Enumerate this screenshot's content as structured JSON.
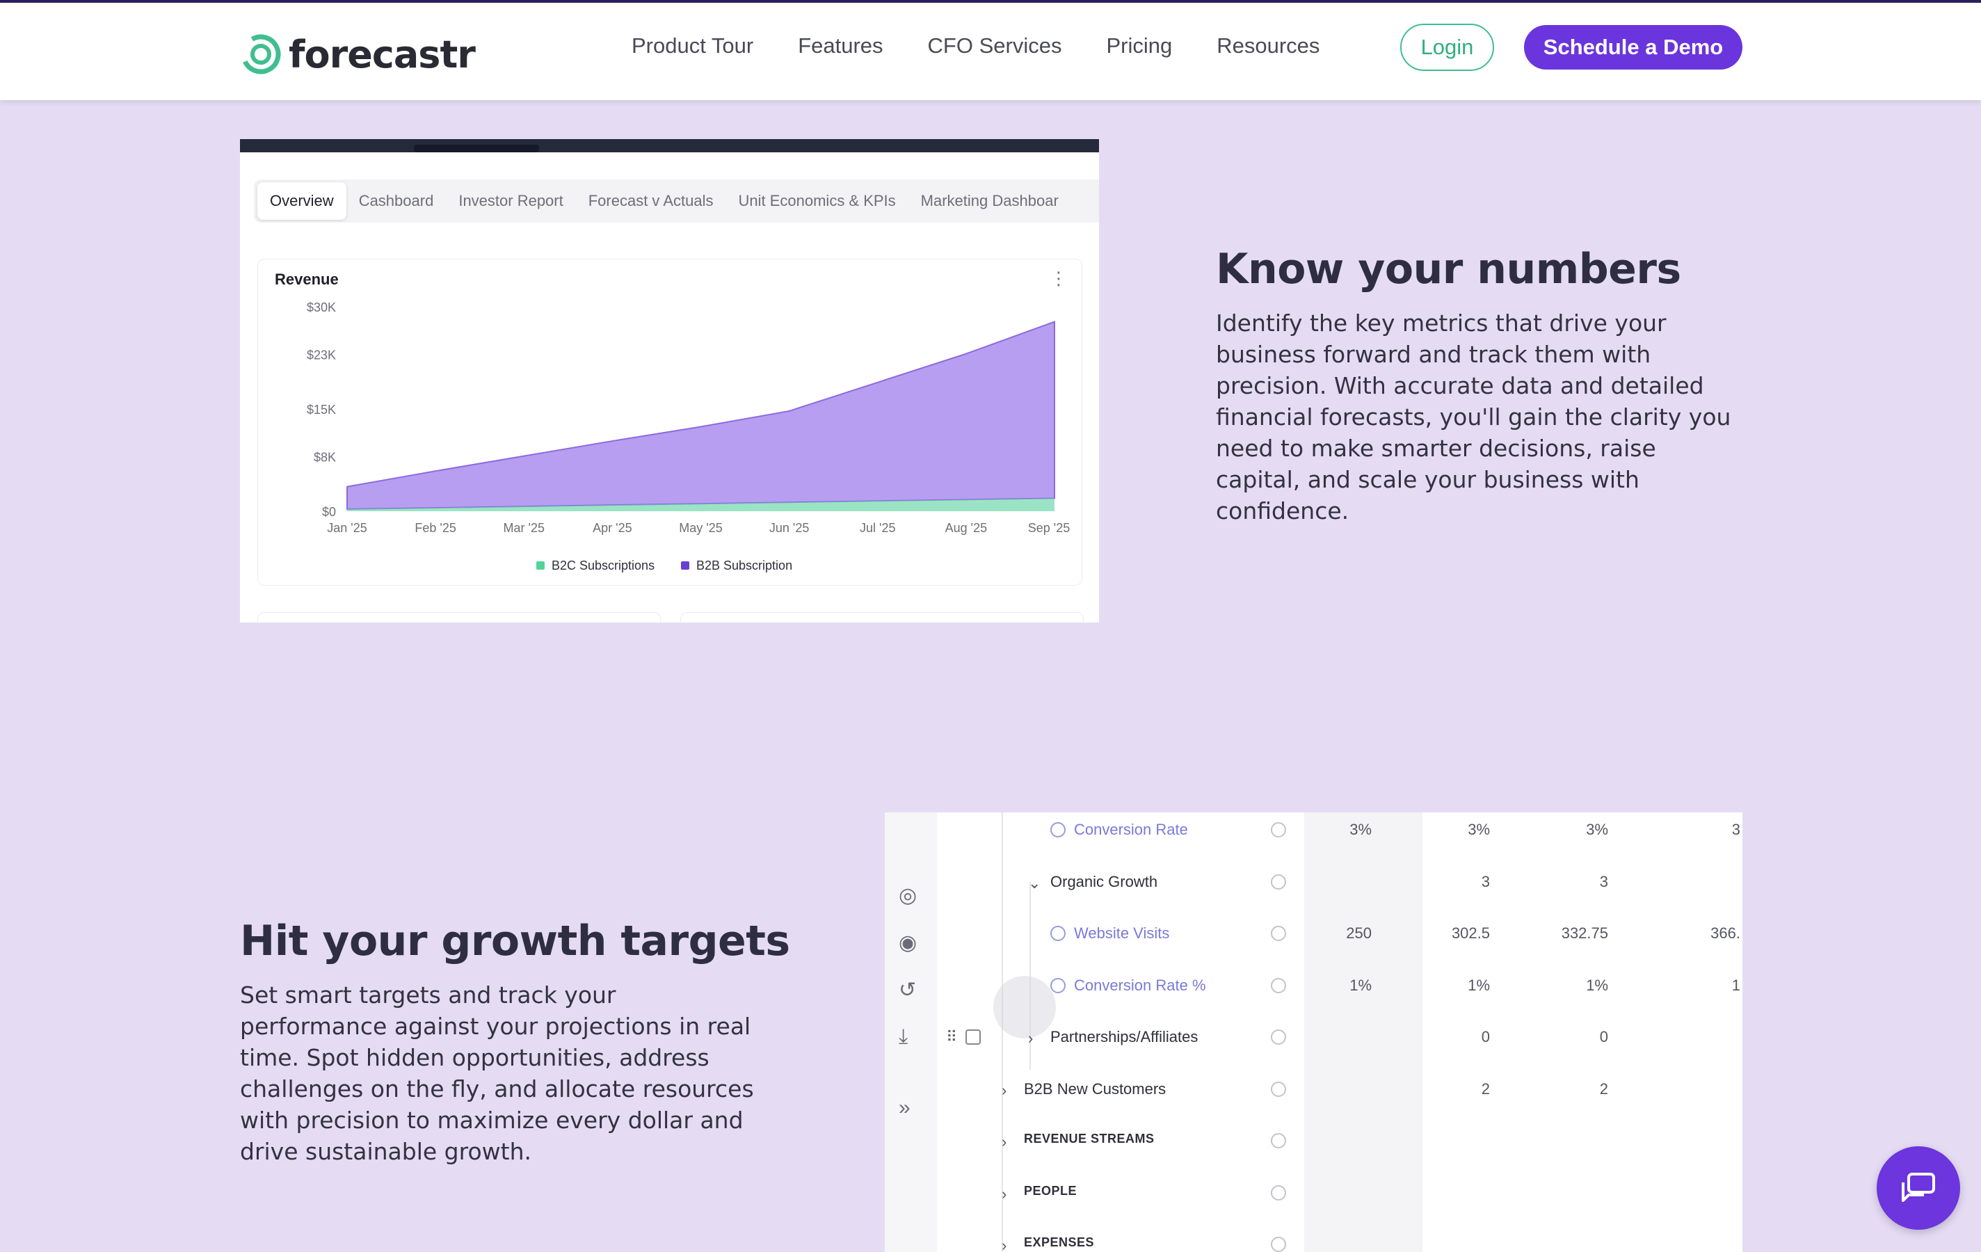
{
  "brand": {
    "name": "forecastr",
    "accent": "#6a35dd",
    "green": "#3fbf8f",
    "background": "#e5dcf4"
  },
  "nav": {
    "links": [
      "Product Tour",
      "Features",
      "CFO Services",
      "Pricing",
      "Resources"
    ],
    "login_label": "Login",
    "demo_label": "Schedule a Demo"
  },
  "dashboard": {
    "tabs": [
      "Overview",
      "Cashboard",
      "Investor Report",
      "Forecast v Actuals",
      "Unit Economics & KPIs",
      "Marketing Dashboar"
    ],
    "active_tab": "Overview",
    "card_title": "Revenue",
    "menu_icon": "kebab-icon"
  },
  "chart_data": {
    "type": "area",
    "title": "Revenue",
    "x": [
      "Jan '25",
      "Feb '25",
      "Mar '25",
      "Apr '25",
      "May '25",
      "Jun '25",
      "Jul '25",
      "Aug '25",
      "Sep '25"
    ],
    "yticks": [
      "$30K",
      "$23K",
      "$15K",
      "$8K",
      "$0"
    ],
    "ytick_values": [
      30000,
      23000,
      15000,
      8000,
      0
    ],
    "ylim": [
      0,
      30000
    ],
    "stacked": true,
    "legend_position": "bottom",
    "series": [
      {
        "name": "B2C Subscriptions",
        "color": "#6fd9ad",
        "values": [
          300,
          500,
          700,
          900,
          1100,
          1300,
          1500,
          1700,
          1900
        ]
      },
      {
        "name": "B2B Subscription",
        "color": "#b79ef0",
        "values": [
          3300,
          5400,
          7400,
          9400,
          11300,
          13400,
          17400,
          21400,
          25900
        ]
      }
    ]
  },
  "section1": {
    "heading": "Know your numbers",
    "body": "Identify the key metrics that drive your business forward and track them with precision. With accurate data and detailed financial forecasts, you'll gain the clarity you need to make smarter decisions, raise capital, and scale your business with confidence."
  },
  "section2": {
    "heading": "Hit your growth targets",
    "body": "Set smart targets and track your performance against your projections in real time. Spot hidden opportunities, address challenges on the fly, and allocate resources with precision to maximize every dollar and drive sustainable growth."
  },
  "model_table": {
    "rail_icons": [
      "globe-icon",
      "eye-icon",
      "history-icon",
      "download-icon",
      "expand-icon"
    ],
    "rows": [
      {
        "label": "Conversion Rate",
        "values": [
          "3%",
          "3%",
          "3%",
          "3"
        ]
      },
      {
        "label": "Organic Growth",
        "values": [
          "",
          "3",
          "3",
          ""
        ]
      },
      {
        "label": "Website Visits",
        "values": [
          "250",
          "302.5",
          "332.75",
          "366."
        ]
      },
      {
        "label": "Conversion Rate %",
        "values": [
          "1%",
          "1%",
          "1%",
          "1"
        ]
      },
      {
        "label": "Partnerships/Affiliates",
        "values": [
          "",
          "0",
          "0",
          ""
        ]
      },
      {
        "label": "B2B New Customers",
        "values": [
          "",
          "2",
          "2",
          ""
        ]
      },
      {
        "label": "REVENUE STREAMS",
        "values": [
          "",
          "",
          "",
          ""
        ]
      },
      {
        "label": "PEOPLE",
        "values": [
          "",
          "",
          "",
          ""
        ]
      },
      {
        "label": "EXPENSES",
        "values": [
          "",
          "",
          "",
          ""
        ]
      }
    ]
  },
  "chat": {
    "icon": "chat-icon"
  }
}
